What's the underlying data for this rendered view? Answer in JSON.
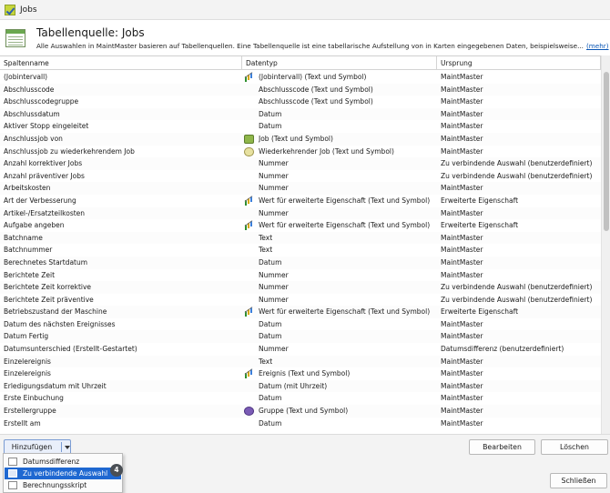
{
  "window": {
    "title": "Jobs"
  },
  "header": {
    "title": "Tabellenquelle: Jobs",
    "description": "Alle Auswahlen in MaintMaster basieren auf Tabellenquellen. Eine Tabellenquelle ist eine tabellarische Aufstellung von in Karten eingegebenen Daten, beispielsweise...",
    "more_link": "(mehr)"
  },
  "columns": {
    "name": "Spaltenname",
    "type": "Datentyp",
    "origin": "Ursprung"
  },
  "rows": [
    {
      "name": "(Jobintervall)",
      "type": "(Jobintervall) (Text und Symbol)",
      "icon": "bar-chart-icon",
      "origin": "MaintMaster"
    },
    {
      "name": "Abschlusscode",
      "type": "Abschlusscode (Text und Symbol)",
      "icon": "",
      "origin": "MaintMaster"
    },
    {
      "name": "Abschlusscodegruppe",
      "type": "Abschlusscode (Text und Symbol)",
      "icon": "",
      "origin": "MaintMaster"
    },
    {
      "name": "Abschlussdatum",
      "type": "Datum",
      "icon": "",
      "origin": "MaintMaster"
    },
    {
      "name": "Aktiver Stopp eingeleitet",
      "type": "Datum",
      "icon": "",
      "origin": "MaintMaster"
    },
    {
      "name": "Anschlussjob von",
      "type": "Job (Text und Symbol)",
      "icon": "job-icon",
      "origin": "MaintMaster"
    },
    {
      "name": "Anschlussjob zu wiederkehrendem Job",
      "type": "Wiederkehrender Job (Text und Symbol)",
      "icon": "recurring-job-icon",
      "origin": "MaintMaster"
    },
    {
      "name": "Anzahl korrektiver Jobs",
      "type": "Nummer",
      "icon": "",
      "origin": "Zu verbindende Auswahl (benutzerdefiniert)"
    },
    {
      "name": "Anzahl präventiver Jobs",
      "type": "Nummer",
      "icon": "",
      "origin": "Zu verbindende Auswahl (benutzerdefiniert)"
    },
    {
      "name": "Arbeitskosten",
      "type": "Nummer",
      "icon": "",
      "origin": "MaintMaster"
    },
    {
      "name": "Art der Verbesserung",
      "type": "Wert für erweiterte Eigenschaft (Text und Symbol)",
      "icon": "bar-chart-icon",
      "origin": "Erweiterte Eigenschaft"
    },
    {
      "name": "Artikel-/Ersatzteilkosten",
      "type": "Nummer",
      "icon": "",
      "origin": "MaintMaster"
    },
    {
      "name": "Aufgabe angeben",
      "type": "Wert für erweiterte Eigenschaft (Text und Symbol)",
      "icon": "bar-chart-icon",
      "origin": "Erweiterte Eigenschaft"
    },
    {
      "name": "Batchname",
      "type": "Text",
      "icon": "",
      "origin": "MaintMaster"
    },
    {
      "name": "Batchnummer",
      "type": "Text",
      "icon": "",
      "origin": "MaintMaster"
    },
    {
      "name": "Berechnetes Startdatum",
      "type": "Datum",
      "icon": "",
      "origin": "MaintMaster"
    },
    {
      "name": "Berichtete Zeit",
      "type": "Nummer",
      "icon": "",
      "origin": "MaintMaster"
    },
    {
      "name": "Berichtete Zeit korrektive",
      "type": "Nummer",
      "icon": "",
      "origin": "Zu verbindende Auswahl (benutzerdefiniert)"
    },
    {
      "name": "Berichtete Zeit präventive",
      "type": "Nummer",
      "icon": "",
      "origin": "Zu verbindende Auswahl (benutzerdefiniert)"
    },
    {
      "name": "Betriebszustand der Maschine",
      "type": "Wert für erweiterte Eigenschaft (Text und Symbol)",
      "icon": "bar-chart-icon",
      "origin": "Erweiterte Eigenschaft"
    },
    {
      "name": "Datum des nächsten Ereignisses",
      "type": "Datum",
      "icon": "",
      "origin": "MaintMaster"
    },
    {
      "name": "Datum Fertig",
      "type": "Datum",
      "icon": "",
      "origin": "MaintMaster"
    },
    {
      "name": "Datumsunterschied (Erstellt-Gestartet)",
      "type": "Nummer",
      "icon": "",
      "origin": "Datumsdifferenz (benutzerdefiniert)"
    },
    {
      "name": "Einzelereignis",
      "type": "Text",
      "icon": "",
      "origin": "MaintMaster"
    },
    {
      "name": "Einzelereignis",
      "type": "Ereignis (Text und Symbol)",
      "icon": "bar-chart-icon",
      "origin": "MaintMaster"
    },
    {
      "name": "Erledigungsdatum mit Uhrzeit",
      "type": "Datum (mit Uhrzeit)",
      "icon": "",
      "origin": "MaintMaster"
    },
    {
      "name": "Erste Einbuchung",
      "type": "Datum",
      "icon": "",
      "origin": "MaintMaster"
    },
    {
      "name": "Erstellergruppe",
      "type": "Gruppe (Text und Symbol)",
      "icon": "group-icon",
      "origin": "MaintMaster"
    },
    {
      "name": "Erstellt am",
      "type": "Datum",
      "icon": "",
      "origin": "MaintMaster"
    }
  ],
  "footer": {
    "add_button": "Hinzufügen",
    "edit_button": "Bearbeiten",
    "delete_button": "Löschen",
    "close_button": "Schließen"
  },
  "dropdown": {
    "items": [
      {
        "label": "Datumsdifferenz",
        "selected": false
      },
      {
        "label": "Zu verbindende Auswahl",
        "selected": true
      },
      {
        "label": "Berechnungsskript",
        "selected": false
      }
    ],
    "badge": "4"
  }
}
